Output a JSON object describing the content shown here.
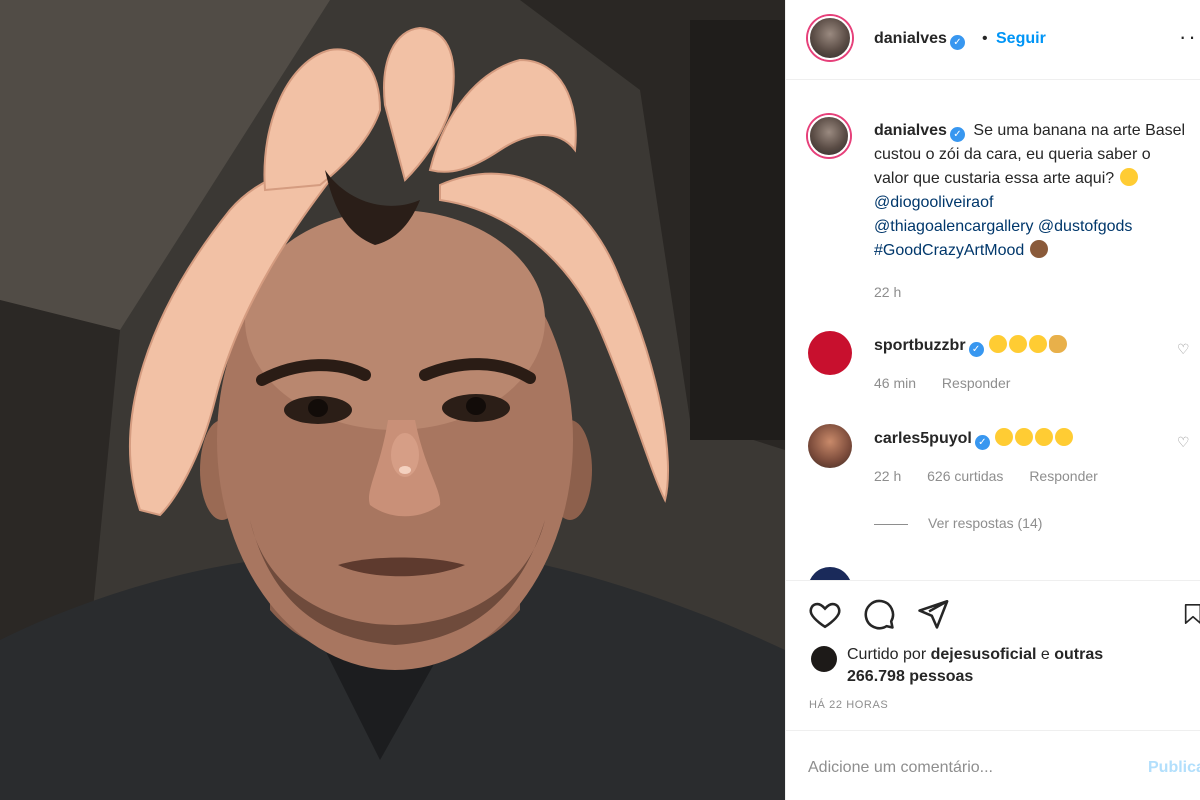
{
  "post": {
    "username": "danialves",
    "follow_label": "Seguir",
    "separator": "•",
    "more_label": "···"
  },
  "caption": {
    "username": "danialves",
    "text": "Se uma banana na arte Basel custou o zói da cara, eu queria saber o valor que custaria essa arte aqui?",
    "mention1": "@diogooliveiraof",
    "mention2": "@thiagoalencargallery",
    "mention3": "@dustofgods",
    "hashtag": "#GoodCrazyArtMood",
    "time": "22 h"
  },
  "comments": [
    {
      "username": "sportbuzzbr",
      "avatar_color": "#c8102e",
      "time": "46 min",
      "likes": "",
      "reply_label": "Responder"
    },
    {
      "username": "carles5puyol",
      "avatar_color": "#7a4a3a",
      "time": "22 h",
      "likes": "626 curtidas",
      "reply_label": "Responder"
    }
  ],
  "view_replies": "Ver respostas (14)",
  "likes": {
    "prefix": "Curtido por",
    "user": "dejesusoficial",
    "connector": "e",
    "others": "outras 266.798 pessoas"
  },
  "posted_ago": "HÁ 22 HORAS",
  "add_comment": {
    "placeholder": "Adicione um comentário...",
    "publish_label": "Publicar"
  },
  "colors": {
    "accent": "#0095f6",
    "verified": "#3897f0",
    "mention": "#00376b",
    "muted": "#8e8e8e"
  }
}
